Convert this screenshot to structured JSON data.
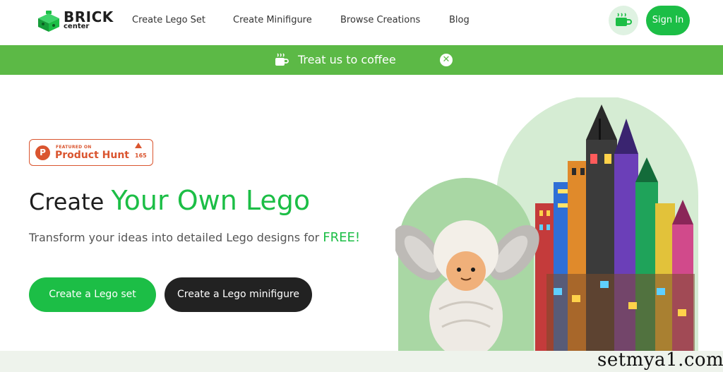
{
  "brand": {
    "name": "BRICK",
    "sub": "center"
  },
  "nav": {
    "items": [
      "Create Lego Set",
      "Create Minifigure",
      "Browse Creations",
      "Blog"
    ],
    "signin_label": "Sign In",
    "coffee_icon": "coffee-cup-icon"
  },
  "banner": {
    "text": "Treat us to coffee",
    "close_icon": "close-icon"
  },
  "producthunt": {
    "featured": "FEATURED ON",
    "name": "Product Hunt",
    "count": "165"
  },
  "hero": {
    "title_plain": "Create",
    "title_accent": "Your Own Lego",
    "subtitle": "Transform your ideas into detailed Lego designs for",
    "subtitle_accent": "FREE!",
    "primary_button": "Create a Lego set",
    "secondary_button": "Create a Lego minifigure"
  },
  "watermark": "setmya1.com",
  "colors": {
    "accent": "#1cbe46",
    "banner": "#5cb946",
    "dark": "#222222",
    "producthunt": "#da552f"
  }
}
